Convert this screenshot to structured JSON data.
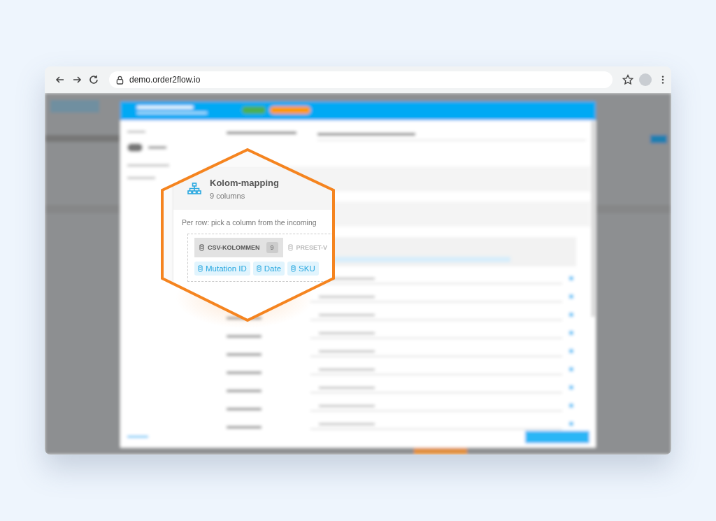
{
  "browser": {
    "url": "demo.order2flow.io"
  },
  "magnifier": {
    "title": "Kolom-mapping",
    "subtitle": "9 columns",
    "hint": "Per row: pick a column from the incoming",
    "tabs": [
      {
        "label": "CSV-KOLOMMEN",
        "count": "9",
        "selected": true
      },
      {
        "label": "PRESET-V",
        "selected": false
      }
    ],
    "chips": [
      "Mutation ID",
      "Date",
      "SKU"
    ]
  }
}
